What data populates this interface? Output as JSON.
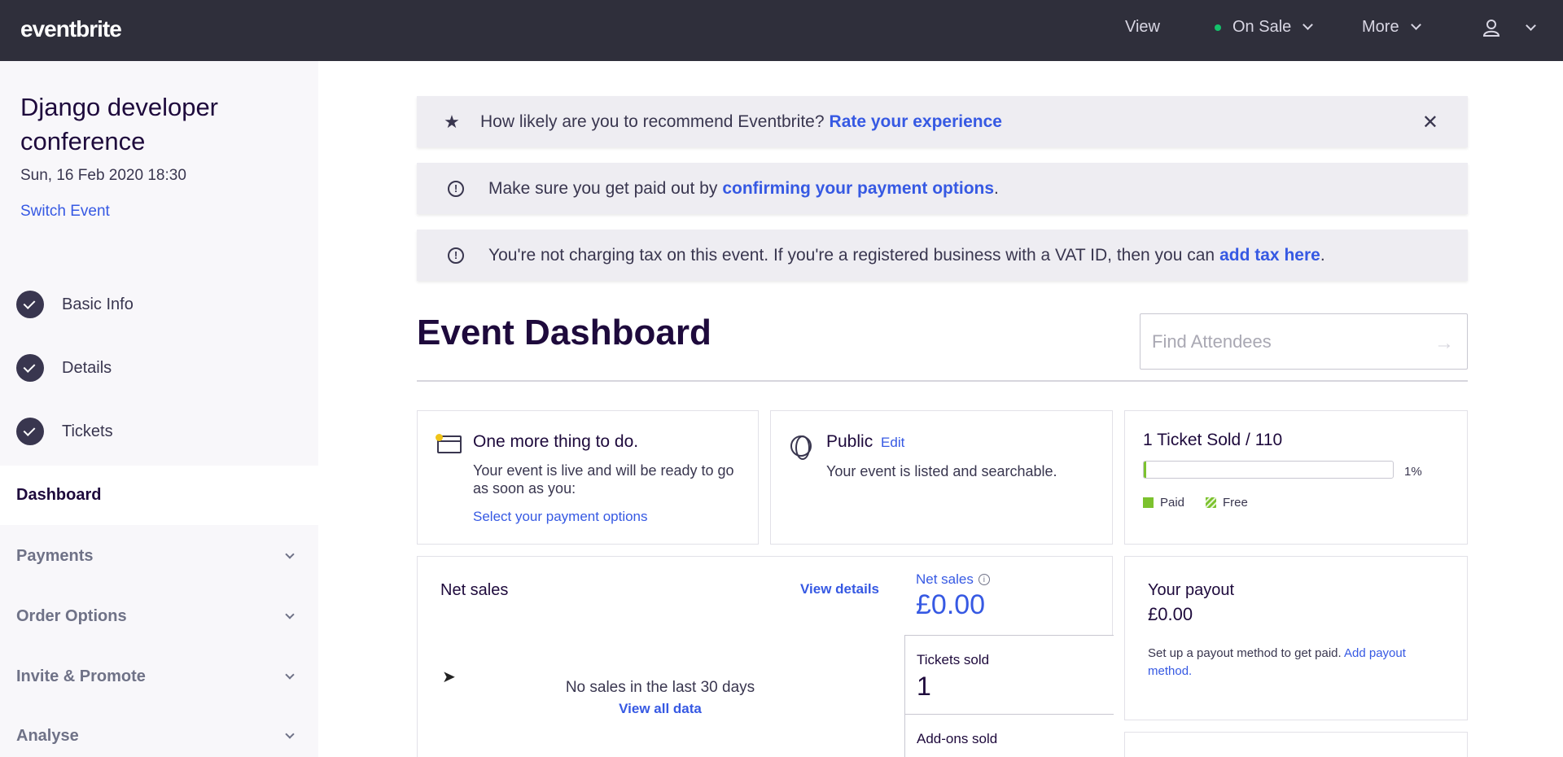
{
  "header": {
    "logo": "eventbrite",
    "view": "View",
    "status": "On Sale",
    "more": "More"
  },
  "sidebar": {
    "event_title": "Django developer conference",
    "event_date": "Sun, 16 Feb 2020 18:30",
    "switch_event": "Switch Event",
    "steps": [
      {
        "label": "Basic Info"
      },
      {
        "label": "Details"
      },
      {
        "label": "Tickets"
      }
    ],
    "active": "Dashboard",
    "sections": [
      {
        "label": "Payments"
      },
      {
        "label": "Order Options"
      },
      {
        "label": "Invite & Promote"
      },
      {
        "label": "Analyse"
      }
    ]
  },
  "banners": {
    "rate": {
      "text": "How likely are you to recommend Eventbrite?",
      "link": "Rate your experience"
    },
    "payment": {
      "text": "Make sure you get paid out by",
      "link": "confirming your payment options",
      "end": "."
    },
    "tax": {
      "text": "You're not charging tax on this event. If you're a registered business with a VAT ID, then you can",
      "link": "add tax here",
      "end": "."
    }
  },
  "dashboard": {
    "title": "Event Dashboard",
    "search_placeholder": "Find Attendees"
  },
  "todo_card": {
    "title": "One more thing to do.",
    "body": "Your event is live and will be ready to go as soon as you:",
    "link": "Select your payment options"
  },
  "public_card": {
    "title": "Public",
    "edit": "Edit",
    "body": "Your event is listed and searchable."
  },
  "tickets_card": {
    "title": "1 Ticket Sold / 110",
    "progress": 0.01,
    "percent_label": "1%",
    "legend_paid": "Paid",
    "legend_free": "Free"
  },
  "sales_card": {
    "title": "Net sales",
    "view_details": "View details",
    "empty": "No sales in the last 30 days",
    "view_all": "View all data",
    "net_sales_label": "Net sales",
    "net_sales_value": "£0.00",
    "tickets_sold_label": "Tickets sold",
    "tickets_sold_value": "1",
    "addons_label": "Add-ons sold"
  },
  "payout_card": {
    "title": "Your payout",
    "value": "£0.00",
    "body": "Set up a payout method to get paid.",
    "link": "Add payout method."
  },
  "colors": {
    "topbar": "#2f2f3b",
    "link": "#3659e3",
    "progress": "#7cc22e",
    "status_dot": "#14c26b"
  }
}
